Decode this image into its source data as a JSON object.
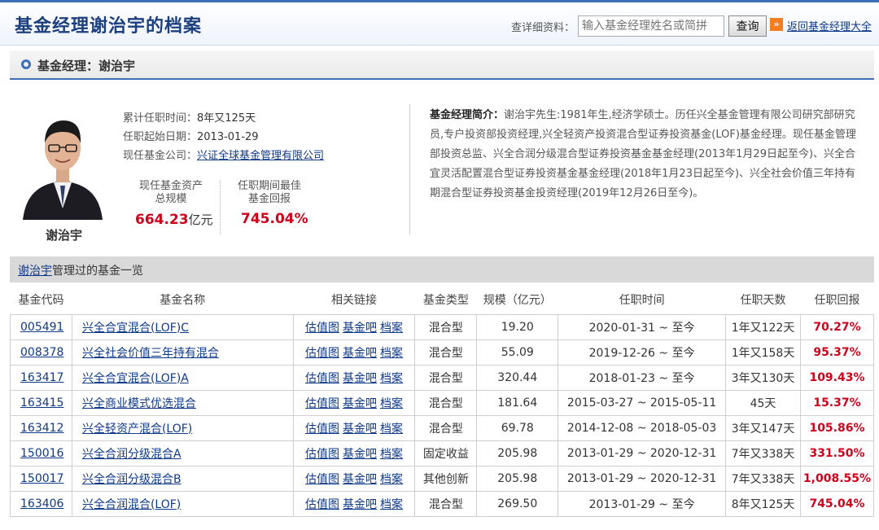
{
  "header": {
    "title": "基金经理谢治宇的档案",
    "search_label": "查详细资料：",
    "search_placeholder": "输入基金经理姓名或简拼",
    "search_button": "查询",
    "back_link": "返回基金经理大全"
  },
  "section": {
    "title": "基金经理：谢治宇"
  },
  "profile": {
    "name": "谢治宇",
    "tenure_label": "累计任职时间：",
    "tenure_value": "8年又125天",
    "start_label": "任职起始日期：",
    "start_value": "2013-01-29",
    "company_label": "现任基金公司：",
    "company_value": "兴证全球基金管理有限公司",
    "aum_label_1": "现任基金资产",
    "aum_label_2": "总规模",
    "aum_value": "664.23",
    "aum_unit": "亿元",
    "best_label_1": "任职期间最佳",
    "best_label_2": "基金回报",
    "best_value": "745.04%",
    "bio_label": "基金经理简介：",
    "bio_text": "谢治宇先生:1981年生,经济学硕士。历任兴全基金管理有限公司研究部研究员,专户投资部投资经理,兴全轻资产投资混合型证券投资基金(LOF)基金经理。现任基金管理部投资总监、兴全合润分级混合型证券投资基金基金经理(2013年1月29日起至今)、兴全合宜灵活配置混合型证券投资基金基金经理(2018年1月23日起至今)、兴全社会价值三年持有期混合型证券投资基金投资经理(2019年12月26日至今)。",
    "colors": {
      "accent": "#3e6fb7",
      "highlight": "#d0021b"
    }
  },
  "fund_list": {
    "title_link": "谢治宇",
    "title_rest": "管理过的基金一览",
    "columns": [
      "基金代码",
      "基金名称",
      "相关链接",
      "基金类型",
      "规模（亿元）",
      "任职时间",
      "任职天数",
      "任职回报"
    ],
    "link_labels": [
      "估值图",
      "基金吧",
      "档案"
    ],
    "rows": [
      {
        "code": "005491",
        "name": "兴全合宜混合(LOF)C",
        "type": "混合型",
        "size": "19.20",
        "period": "2020-01-31 ~ 至今",
        "days": "1年又122天",
        "return": "70.27%"
      },
      {
        "code": "008378",
        "name": "兴全社会价值三年持有混合",
        "type": "混合型",
        "size": "55.09",
        "period": "2019-12-26 ~ 至今",
        "days": "1年又158天",
        "return": "95.37%"
      },
      {
        "code": "163417",
        "name": "兴全合宜混合(LOF)A",
        "type": "混合型",
        "size": "320.44",
        "period": "2018-01-23 ~ 至今",
        "days": "3年又130天",
        "return": "109.43%"
      },
      {
        "code": "163415",
        "name": "兴全商业模式优选混合",
        "type": "混合型",
        "size": "181.64",
        "period": "2015-03-27 ~ 2015-05-11",
        "days": "45天",
        "return": "15.37%"
      },
      {
        "code": "163412",
        "name": "兴全轻资产混合(LOF)",
        "type": "混合型",
        "size": "69.78",
        "period": "2014-12-08 ~ 2018-05-03",
        "days": "3年又147天",
        "return": "105.86%"
      },
      {
        "code": "150016",
        "name": "兴全合润分级混合A",
        "type": "固定收益",
        "size": "205.98",
        "period": "2013-01-29 ~ 2020-12-31",
        "days": "7年又338天",
        "return": "331.50%"
      },
      {
        "code": "150017",
        "name": "兴全合润分级混合B",
        "type": "其他创新",
        "size": "205.98",
        "period": "2013-01-29 ~ 2020-12-31",
        "days": "7年又338天",
        "return": "1,008.55%"
      },
      {
        "code": "163406",
        "name": "兴全合润混合(LOF)",
        "type": "混合型",
        "size": "269.50",
        "period": "2013-01-29 ~ 至今",
        "days": "8年又125天",
        "return": "745.04%"
      }
    ]
  }
}
